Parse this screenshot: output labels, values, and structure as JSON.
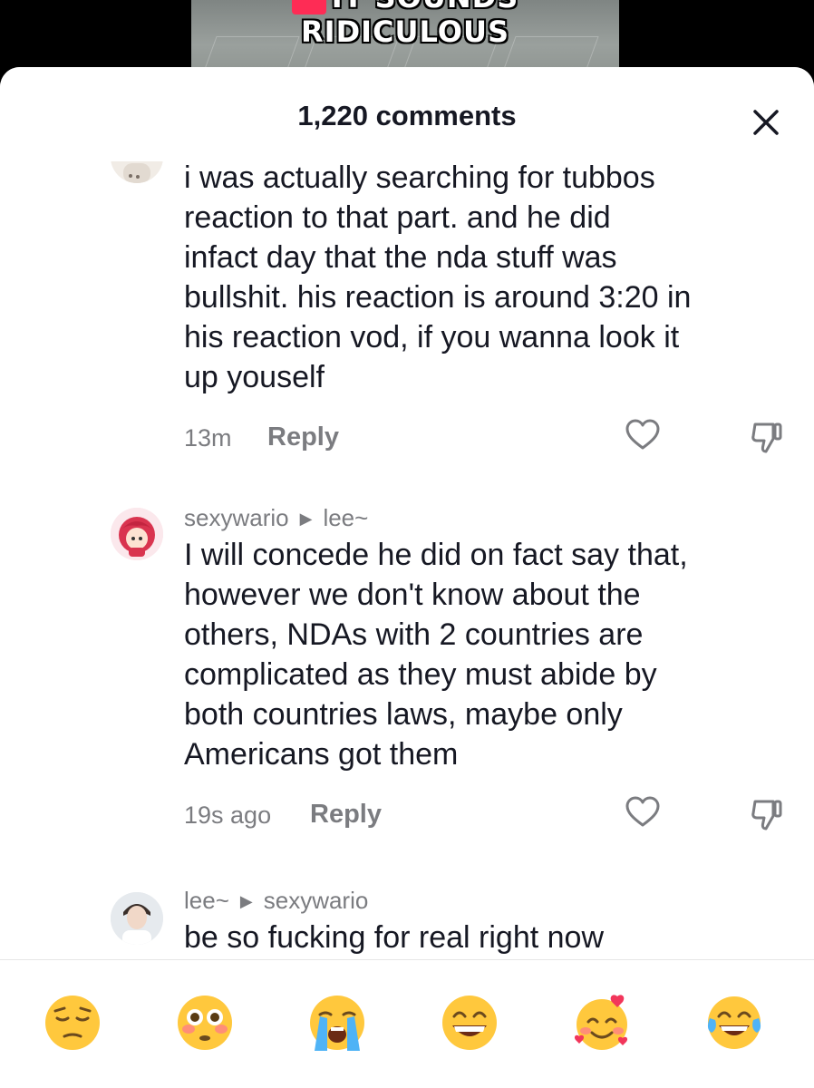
{
  "video": {
    "caption": "IT SOUNDS RIDICULOUS"
  },
  "header": {
    "title": "1,220 comments",
    "close_icon": "close-icon"
  },
  "comments": [
    {
      "username": "",
      "reply_to": "",
      "text_lines": [
        "i was actually searching for tubbos",
        "reaction to that part. and he did",
        "infact day that the nda stuff was",
        "bullshit. his reaction is around 3:20 in",
        "his reaction vod, if you wanna look it",
        "up youself"
      ],
      "time": "13m",
      "reply_label": "Reply"
    },
    {
      "username": "sexywario",
      "reply_to": "lee~",
      "text_lines": [
        "I will concede he did on fact say that,",
        "however we don't know about the",
        "others, NDAs with 2 countries are",
        "complicated as they must abide by",
        "both countries laws, maybe only",
        "Americans got them"
      ],
      "time": "19s ago",
      "reply_label": "Reply"
    },
    {
      "username": "lee~",
      "reply_to": "sexywario",
      "text_lines": [
        "be so fucking for real right now"
      ],
      "time": "",
      "reply_label": ""
    }
  ],
  "emoji_bar": [
    {
      "icon": "pensive-face-emoji",
      "char": "😔"
    },
    {
      "icon": "flushed-face-emoji",
      "char": "😳"
    },
    {
      "icon": "loudly-crying-face-emoji",
      "char": "😭"
    },
    {
      "icon": "grinning-face-emoji",
      "char": "😁"
    },
    {
      "icon": "smiling-face-with-hearts-emoji",
      "char": "🥰"
    },
    {
      "icon": "tears-of-joy-emoji",
      "char": "😂"
    }
  ],
  "colors": {
    "accent": "#fe2c55",
    "text_primary": "#161823",
    "text_secondary": "#7b7c80"
  }
}
